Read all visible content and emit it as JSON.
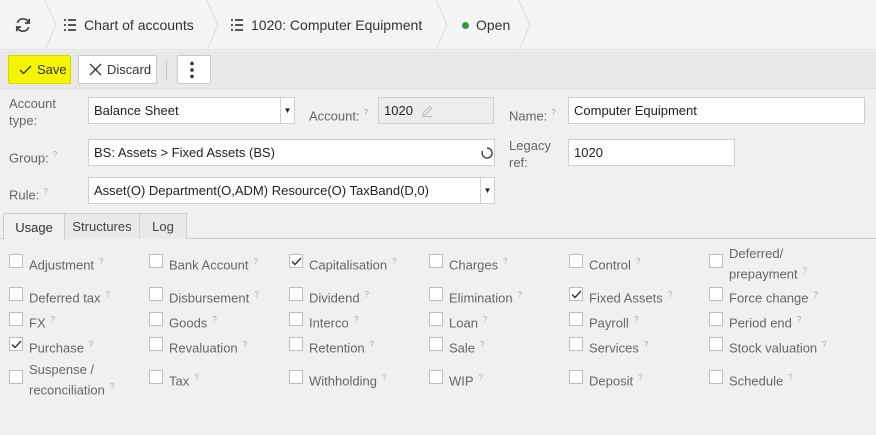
{
  "breadcrumb": {
    "items": [
      {
        "label": "Chart of accounts"
      },
      {
        "label": "1020: Computer Equipment"
      },
      {
        "label": "Open"
      }
    ]
  },
  "toolbar": {
    "save_label": "Save",
    "discard_label": "Discard"
  },
  "form": {
    "account_type": {
      "label": "Account type:",
      "value": "Balance Sheet"
    },
    "account": {
      "label": "Account:",
      "value": "1020"
    },
    "name": {
      "label": "Name:",
      "value": "Computer Equipment"
    },
    "group": {
      "label": "Group:",
      "value": "BS: Assets > Fixed Assets (BS)"
    },
    "legacy_ref": {
      "label": "Legacy ref:",
      "value": "1020"
    },
    "rule": {
      "label": "Rule:",
      "value": "Asset(O) Department(O,ADM) Resource(O) TaxBand(D,0)"
    }
  },
  "help_marker": "?",
  "tabs": [
    {
      "label": "Usage",
      "active": true
    },
    {
      "label": "Structures",
      "active": false
    },
    {
      "label": "Log",
      "active": false
    }
  ],
  "usage": [
    {
      "label": "Adjustment",
      "checked": false
    },
    {
      "label": "Bank Account",
      "checked": false
    },
    {
      "label": "Capitalisation",
      "checked": true
    },
    {
      "label": "Charges",
      "checked": false
    },
    {
      "label": "Control",
      "checked": false
    },
    {
      "label": "Deferred/ prepayment",
      "checked": false
    },
    {
      "label": "Deferred tax",
      "checked": false
    },
    {
      "label": "Disbursement",
      "checked": false
    },
    {
      "label": "Dividend",
      "checked": false
    },
    {
      "label": "Elimination",
      "checked": false
    },
    {
      "label": "Fixed Assets",
      "checked": true
    },
    {
      "label": "Force change",
      "checked": false
    },
    {
      "label": "FX",
      "checked": false
    },
    {
      "label": "Goods",
      "checked": false
    },
    {
      "label": "Interco",
      "checked": false
    },
    {
      "label": "Loan",
      "checked": false
    },
    {
      "label": "Payroll",
      "checked": false
    },
    {
      "label": "Period end",
      "checked": false
    },
    {
      "label": "Purchase",
      "checked": true
    },
    {
      "label": "Revaluation",
      "checked": false
    },
    {
      "label": "Retention",
      "checked": false
    },
    {
      "label": "Sale",
      "checked": false
    },
    {
      "label": "Services",
      "checked": false
    },
    {
      "label": "Stock valuation",
      "checked": false
    },
    {
      "label": "Suspense / reconciliation",
      "checked": false
    },
    {
      "label": "Tax",
      "checked": false
    },
    {
      "label": "Withholding",
      "checked": false
    },
    {
      "label": "WIP",
      "checked": false
    },
    {
      "label": "Deposit",
      "checked": false
    },
    {
      "label": "Schedule",
      "checked": false
    }
  ],
  "colors": {
    "save_button": "#f5f500",
    "status_dot": "#2e9c3a"
  }
}
